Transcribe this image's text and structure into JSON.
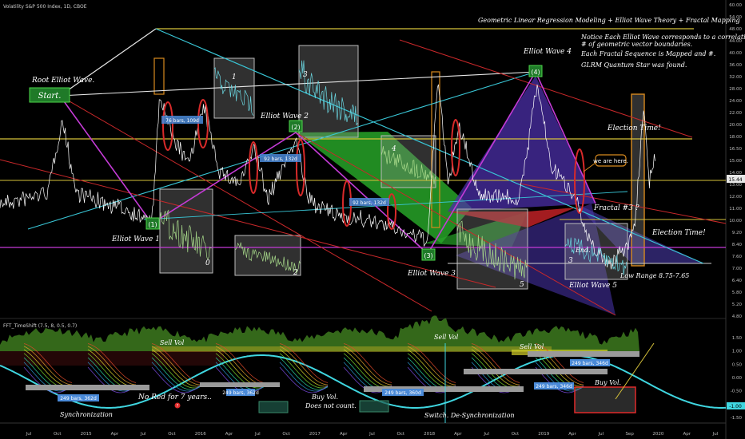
{
  "header": {
    "symbol_label": "Volatility S&P 500 Index, 1D, CBOE",
    "title": "Geometric Linear Regression Modeling + Elliot Wave Theory + Fractal Mapping",
    "notes": [
      "Notice Each Elliot Wave corresponds to a correlating",
      "# of geometric vector boundaries.",
      "Each Fractal Sequence is Mapped and #.",
      "GLRM Quantum Star was found."
    ]
  },
  "annotations": {
    "root_wave": "Root Elliot Wave.",
    "start": "Start.",
    "wave1": "Elliot Wave 1",
    "wave2": "Elliot Wave 2",
    "wave3": "Elliot Wave 3",
    "wave4": "Elliot Wave 4",
    "wave5": "Elliot Wave 5",
    "marker1": "(1)",
    "marker2": "(2)",
    "marker3": "(3)",
    "marker4": "(4)",
    "election1": "Election Time!",
    "election2": "Election Time!",
    "we_are_here": "we are here.",
    "fractal3": "Fractal #3 ?",
    "end": "End.",
    "low_range": "Low Range 8.75-7.65",
    "fractal_labels": [
      "0",
      "1",
      "2",
      "3",
      "4",
      "5",
      "3"
    ],
    "bars1": "76 bars, 109d",
    "bars2": "92 bars, 132d",
    "bars3": "92 bars, 132d"
  },
  "indicator": {
    "label": "FFT_TimeShift (7.5, 8, 0.5, 0.7)",
    "sell_vol_1": "Sell Vol",
    "sell_vol_2": "Sell Vol",
    "sell_vol_3": "Sell Vol",
    "buy_vol_1": "Buy Vol.",
    "does_not_count": "Does not count.",
    "buy_vol_2": "Buy Vol.",
    "no_red": "No Red for 7 years..",
    "synchronization": "Synchronization",
    "switch": "Switch. De-Synchronization",
    "bars_a": "249 bars, 362d",
    "bars_b": "249 bars, 362d",
    "bars_c": "249 bars, 360d",
    "bars_d": "249 bars, 346d",
    "bars_e": "249 bars, 346d",
    "axis_ticks": [
      "1.50",
      "1.00",
      "0.50",
      "0.00",
      "-0.50",
      "-1.00",
      "-1.50"
    ],
    "last_value": "-1.00"
  },
  "price_axis": {
    "ticks": [
      "60.00",
      "54.00",
      "48.00",
      "44.00",
      "40.00",
      "36.00",
      "32.00",
      "28.00",
      "24.00",
      "22.00",
      "20.00",
      "18.00",
      "16.50",
      "15.00",
      "14.00",
      "13.00",
      "12.00",
      "11.00",
      "10.00",
      "9.20",
      "8.40",
      "7.60",
      "7.00",
      "6.40",
      "5.80",
      "5.20",
      "4.80"
    ],
    "last_price": "15.44"
  },
  "time_axis": {
    "ticks": [
      "Jul",
      "Oct",
      "2015",
      "Apr",
      "Jul",
      "Oct",
      "2016",
      "Apr",
      "Jul",
      "Oct",
      "2017",
      "Apr",
      "Jul",
      "Oct",
      "2018",
      "Apr",
      "Jul",
      "Oct",
      "2019",
      "Apr",
      "Jul",
      "Sep",
      "2020",
      "Apr",
      "Jul"
    ]
  },
  "colors": {
    "background": "#000000",
    "price_line": "#ffffff",
    "yellow": "#d6c23a",
    "cyan": "#39c6d6",
    "magenta": "#c43bd6",
    "red": "#c8282a",
    "green": "#2fb82a",
    "purple": "#4a2fb0",
    "fractal_box": "#8a8a8a",
    "orange_box": "#d88a1e",
    "label_blue": "#4a8ad8"
  },
  "chart_data": {
    "type": "line",
    "series": [
      {
        "name": "VIX",
        "x": [
          "Jul",
          "Oct",
          "2015",
          "Apr",
          "Jul",
          "Oct",
          "2016",
          "Apr",
          "Jul",
          "Oct",
          "2017",
          "Apr",
          "Jul",
          "Oct",
          "2018",
          "Apr",
          "Jul",
          "Oct",
          "2019",
          "Apr",
          "Jul",
          "Sep",
          "2020"
        ],
        "values": [
          12,
          14,
          17,
          13,
          12,
          24,
          20,
          14,
          12,
          14,
          12,
          11,
          10,
          10,
          24,
          17,
          13,
          20,
          16,
          13,
          16,
          17,
          19
        ]
      }
    ],
    "ylim": [
      4.8,
      60
    ]
  }
}
